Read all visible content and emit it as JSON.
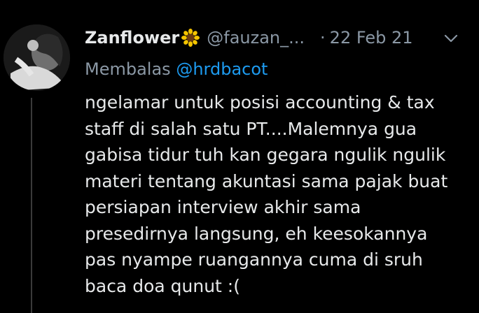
{
  "tweet": {
    "author_name": "Zanflower",
    "author_emoji_icon": "sunflower-icon",
    "handle": "@fauzan_...",
    "separator": "·",
    "date": "22 Feb 21",
    "reply_prefix": "Membalas",
    "reply_to": "@hrdbacot",
    "text": "ngelamar untuk posisi accounting & tax\nstaff di salah satu PT....Malemnya gua\ngabisa tidur tuh kan gegara ngulik ngulik\nmateri tentang akuntasi sama pajak buat\npersiapan interview akhir sama\npresedirnya langsung, eh keesokannya\npas nyampe ruangannya cuma di sruh\nbaca doa qunut :("
  },
  "colors": {
    "background": "#000000",
    "primary_text": "#e7e9ea",
    "secondary_text": "#8b98a5",
    "mention": "#1d9bf0",
    "thread_line": "#3a3a3a"
  }
}
